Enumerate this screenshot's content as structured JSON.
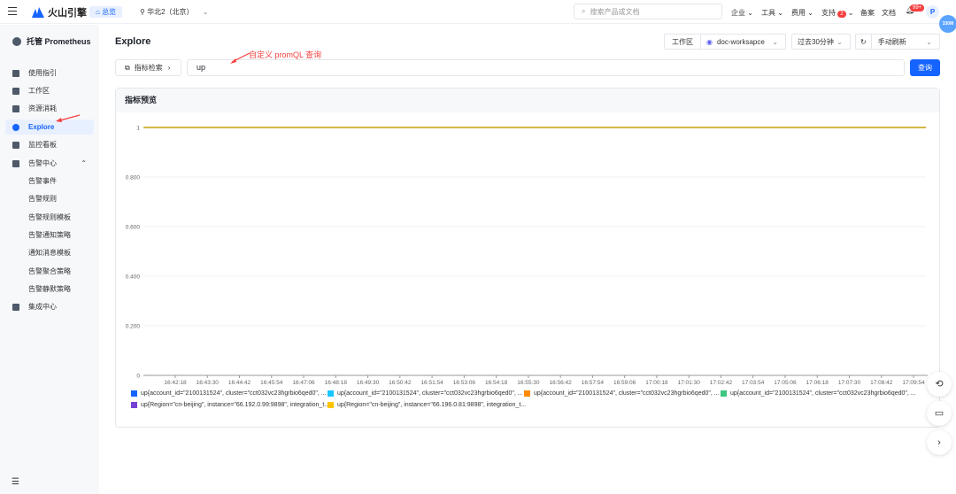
{
  "topbar": {
    "logo": "火山引擎",
    "home": "总览",
    "region": "华北2（北京）",
    "search_placeholder": "搜索产品或文档",
    "nav": [
      "企业",
      "工具",
      "费用",
      "支持",
      "备案",
      "文档"
    ],
    "support_badge": "2",
    "notif_badge": "99+",
    "avatar": "P",
    "memory": "330M"
  },
  "sidebar": {
    "title": "托管 Prometheus",
    "items": [
      {
        "label": "使用指引"
      },
      {
        "label": "工作区"
      },
      {
        "label": "资源消耗"
      },
      {
        "label": "Explore",
        "active": true
      },
      {
        "label": "监控看板"
      },
      {
        "label": "告警中心",
        "expanded": true
      },
      {
        "label": "告警事件",
        "sub": true
      },
      {
        "label": "告警规则",
        "sub": true
      },
      {
        "label": "告警规则模板",
        "sub": true
      },
      {
        "label": "告警通知策略",
        "sub": true
      },
      {
        "label": "通知消息模板",
        "sub": true
      },
      {
        "label": "告警聚合策略",
        "sub": true
      },
      {
        "label": "告警静默策略",
        "sub": true
      },
      {
        "label": "集成中心"
      }
    ]
  },
  "main": {
    "title": "Explore",
    "workspace_label": "工作区",
    "workspace": "doc-worksapce",
    "time_range": "过去30分钟",
    "refresh": "手动刷新",
    "metric_browser": "指标检索",
    "query": "up",
    "query_button": "查询",
    "annotation": "自定义 promQL 查询",
    "card_title": "指标预览"
  },
  "chart_data": {
    "type": "line",
    "ylim": [
      0,
      1
    ],
    "yticks": [
      "0",
      "0.200",
      "0.400",
      "0.600",
      "0.800",
      "1"
    ],
    "x": [
      "16:42:18",
      "16:43:30",
      "16:44:42",
      "16:45:54",
      "16:47:06",
      "16:48:18",
      "16:49:30",
      "16:50:42",
      "16:51:54",
      "16:53:06",
      "16:54:18",
      "16:55:30",
      "16:56:42",
      "16:57:54",
      "16:59:06",
      "17:00:18",
      "17:01:30",
      "17:02:42",
      "17:03:54",
      "17:05:06",
      "17:06:18",
      "17:07:30",
      "17:08:42",
      "17:09:54"
    ],
    "grid": true,
    "legend_placement": "bottom",
    "series": [
      {
        "name": "up{account_id=\"2100131524\", cluster=\"cct032vc23hgrbio6qed0\", ...",
        "color": "#1664ff",
        "value": 1
      },
      {
        "name": "up{account_id=\"2100131524\", cluster=\"cct032vc23hgrbio6qed0\", ...",
        "color": "#1ac6ff",
        "value": 1
      },
      {
        "name": "up{account_id=\"2100131524\", cluster=\"cct032vc23hgrbio6qed0\", ...",
        "color": "#ff8a00",
        "value": 1
      },
      {
        "name": "up{account_id=\"2100131524\", cluster=\"cct032vc23hgrbio6qed0\", ...",
        "color": "#3cc780",
        "value": 1
      },
      {
        "name": "up{Region=\"cn-beijing\", instance=\"66.192.0.99:9898\", integration_t...",
        "color": "#7442d4",
        "value": 1
      },
      {
        "name": "up{Region=\"cn-beijing\", instance=\"66.196.0.81:9898\", integration_t...",
        "color": "#ffc400",
        "value": 1
      }
    ]
  }
}
